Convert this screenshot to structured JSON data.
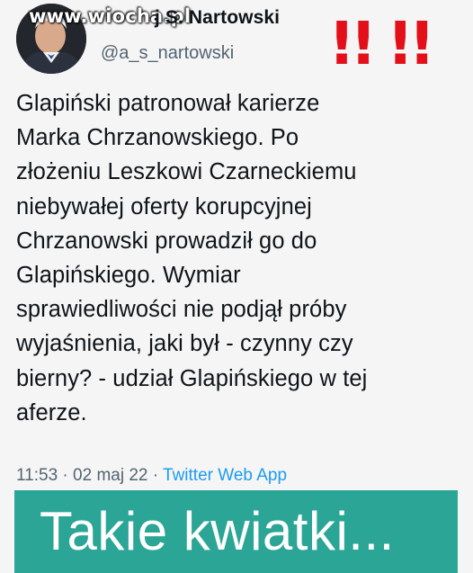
{
  "tweet": {
    "author": {
      "display_name": "Andrzej S. Nartowski",
      "visible_name_part": "j S. Nartowski",
      "handle": "@a_s_nartowski"
    },
    "text": "Glapiński patronował karierze\nMarka Chrzanowskiego. Po\nzłożeniu Leszkowi Czarneckiemu\nniebywałej oferty korupcyjnej\nChrzanowski prowadził go do\nGlapińskiego. Wymiar\nsprawiedliwości nie podjął próby\nwyjaśnienia, jaki był - czynny czy\nbierny? - udział Glapińskiego w tej\naferze.",
    "time": "11:53",
    "date": "02 maj 22",
    "separator": "·",
    "source": "Twitter Web App"
  },
  "overlay": {
    "watermark": "www.wiocha.pl",
    "alert_marks": "!! !!",
    "caption": "Takie kwiatki..."
  },
  "colors": {
    "alert_red": "#e3101a",
    "banner_teal": "#2aa596",
    "link_blue": "#1d9bf0",
    "muted_gray": "#536471"
  },
  "icons": {
    "avatar": "profile-photo-icon"
  }
}
